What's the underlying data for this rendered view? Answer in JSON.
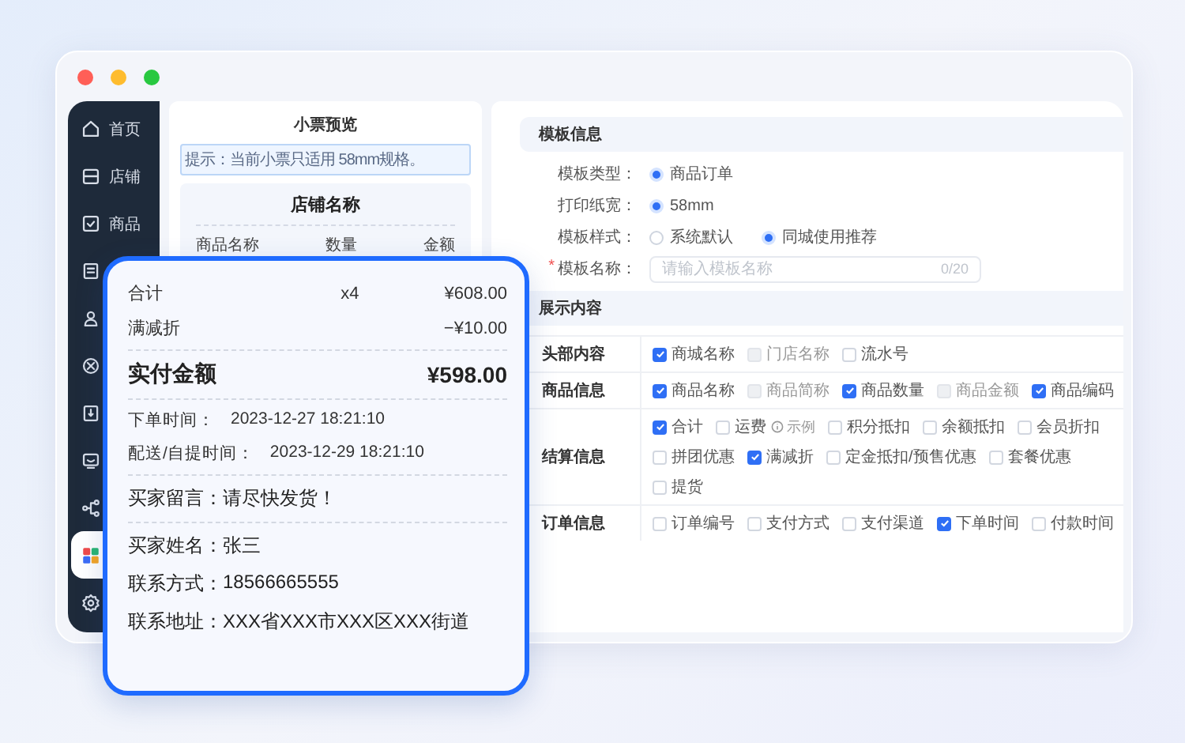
{
  "sidebar": {
    "items": [
      {
        "label": "首页",
        "selected": false
      },
      {
        "label": "店铺",
        "selected": false
      },
      {
        "label": "商品",
        "selected": false
      },
      {
        "selected": false
      },
      {
        "selected": false
      },
      {
        "selected": false
      },
      {
        "selected": false
      },
      {
        "selected": false
      },
      {
        "selected": false
      },
      {
        "selected": true
      },
      {
        "selected": false
      }
    ]
  },
  "preview": {
    "title": "小票预览",
    "tip": "提示：当前小票只适用 58mm规格。",
    "receipt": {
      "store_name": "店铺名称",
      "columns": [
        "商品名称",
        "数量",
        "金额"
      ]
    }
  },
  "template_info": {
    "heading": "模板信息",
    "fields": [
      {
        "kind": "radio",
        "label": "模板类型：",
        "options": [
          {
            "label": "商品订单",
            "selected": true
          }
        ]
      },
      {
        "kind": "radio",
        "label": "打印纸宽：",
        "options": [
          {
            "label": "58mm",
            "selected": true
          }
        ]
      },
      {
        "kind": "radio",
        "label": "模板样式：",
        "options": [
          {
            "label": "系统默认",
            "selected": false
          },
          {
            "label": "同城使用推荐",
            "selected": true
          }
        ]
      },
      {
        "kind": "text",
        "label": "模板名称：",
        "required_mark": "*",
        "placeholder": "请输入模板名称",
        "counter": "0/20"
      }
    ]
  },
  "display_content": {
    "heading": "展示内容",
    "groups": [
      {
        "label": "头部内容",
        "options": [
          {
            "label": "商城名称",
            "checked": true,
            "disabled": false
          },
          {
            "label": "门店名称",
            "checked": false,
            "disabled": true
          },
          {
            "label": "流水号",
            "checked": false,
            "disabled": false
          }
        ]
      },
      {
        "label": "商品信息",
        "options": [
          {
            "label": "商品名称",
            "checked": true,
            "disabled": false
          },
          {
            "label": "商品简称",
            "checked": false,
            "disabled": true
          },
          {
            "label": "商品数量",
            "checked": true,
            "disabled": false
          },
          {
            "label": "商品金额",
            "checked": false,
            "disabled": true
          },
          {
            "label": "商品编码",
            "checked": true,
            "disabled": false
          }
        ]
      },
      {
        "label": "结算信息",
        "options": [
          {
            "label": "合计",
            "checked": true,
            "disabled": false
          },
          {
            "label": "运费",
            "checked": false,
            "disabled": false,
            "hint": "示例"
          },
          {
            "label": "积分抵扣",
            "checked": false,
            "disabled": false
          },
          {
            "label": "余额抵扣",
            "checked": false,
            "disabled": false
          },
          {
            "label": "会员折扣",
            "checked": false,
            "disabled": false
          },
          {
            "label": "拼团优惠",
            "checked": false,
            "disabled": false
          },
          {
            "label": "满减折",
            "checked": true,
            "disabled": false
          },
          {
            "label": "定金抵扣/预售优惠",
            "checked": false,
            "disabled": false
          },
          {
            "label": "套餐优惠",
            "checked": false,
            "disabled": false
          },
          {
            "label": "提货",
            "checked": false,
            "disabled": false
          }
        ]
      },
      {
        "label": "订单信息",
        "options": [
          {
            "label": "订单编号",
            "checked": false,
            "disabled": false
          },
          {
            "label": "支付方式",
            "checked": false,
            "disabled": false
          },
          {
            "label": "支付渠道",
            "checked": false,
            "disabled": false
          },
          {
            "label": "下单时间",
            "checked": true,
            "disabled": false
          },
          {
            "label": "付款时间",
            "checked": false,
            "disabled": false
          }
        ]
      }
    ]
  },
  "receipt_card": {
    "summary": [
      {
        "label": "合计",
        "quantity": "x4",
        "amount": "¥608.00"
      },
      {
        "label": "满减折",
        "amount": "−¥10.00"
      }
    ],
    "total": {
      "label": "实付金额",
      "amount": "¥598.00"
    },
    "times": [
      {
        "label": "下单时间：",
        "value": "2023-12-27 18:21:10"
      },
      {
        "label": "配送/自提时间：",
        "value": "2023-12-29 18:21:10"
      }
    ],
    "message": {
      "label": "买家留言：",
      "value": "请尽快发货！"
    },
    "buyer": [
      {
        "label": "买家姓名：",
        "value": "张三"
      },
      {
        "label": "联系方式：",
        "value": "18566665555"
      },
      {
        "label": "联系地址：",
        "value": "XXX省XXX市XXX区XXX街道"
      }
    ]
  }
}
